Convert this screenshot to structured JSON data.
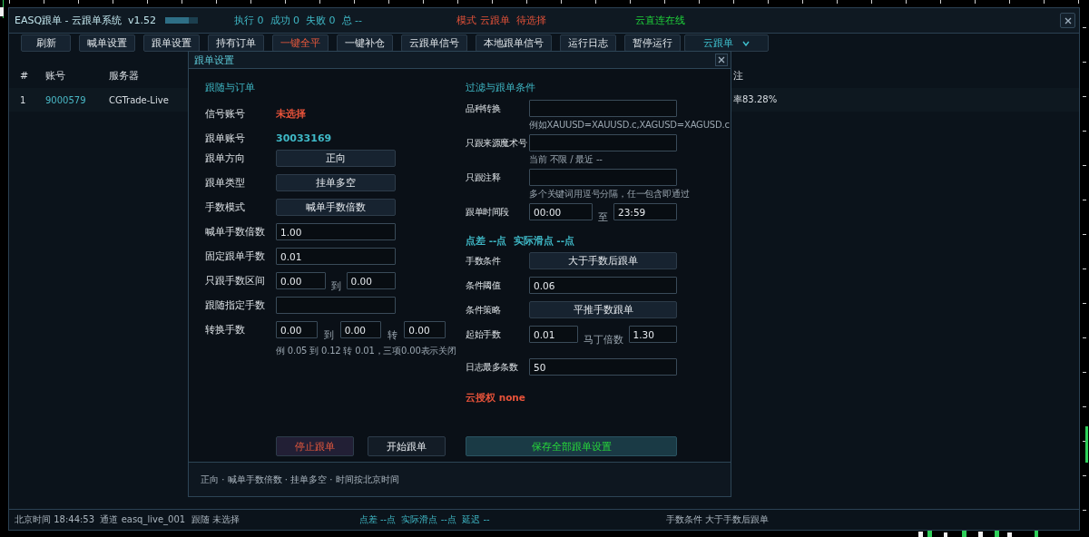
{
  "window": {
    "title": "EASQ跟单 - 云跟单系统  v1.52",
    "stats": "执行 0  成功 0  失败 0  总 --",
    "mode": "模式 云跟单  待选择",
    "connection": "云直连在线"
  },
  "toolbar": [
    {
      "label": "刷新",
      "kind": "normal"
    },
    {
      "label": "喊单设置",
      "kind": "normal"
    },
    {
      "label": "跟单设置",
      "kind": "normal"
    },
    {
      "label": "持有订单",
      "kind": "normal"
    },
    {
      "label": "一键全平",
      "kind": "danger"
    },
    {
      "label": "一键补仓",
      "kind": "normal"
    },
    {
      "label": "云跟单信号",
      "kind": "normal"
    },
    {
      "label": "本地跟单信号",
      "kind": "normal"
    },
    {
      "label": "运行日志",
      "kind": "normal"
    },
    {
      "label": "暂停运行",
      "kind": "normal"
    },
    {
      "label": "云跟单",
      "kind": "dropdown"
    }
  ],
  "table": {
    "columns": [
      "#",
      "账号",
      "服务器",
      "注"
    ],
    "rows": [
      [
        "1",
        "9000579",
        "CGTrade-Live",
        "率83.28%"
      ]
    ]
  },
  "dialog": {
    "title": "跟单设置",
    "left": {
      "heading": "跟随与订单",
      "items": [
        {
          "kind": "text",
          "label": "信号账号",
          "value": "未选择",
          "color": "#e8533a"
        },
        {
          "kind": "text",
          "label": "跟单账号",
          "value": "30033169",
          "color": "#3fb8c6"
        },
        {
          "kind": "select",
          "label": "跟单方向",
          "value": "正向"
        },
        {
          "kind": "select",
          "label": "跟单类型",
          "value": "挂单多空"
        },
        {
          "kind": "select",
          "label": "手数模式",
          "value": "喊单手数倍数"
        },
        {
          "kind": "input",
          "label": "喊单手数倍数",
          "value": "1.00"
        },
        {
          "kind": "input",
          "label": "固定跟单手数",
          "value": "0.01"
        },
        {
          "kind": "range",
          "label": "只跟手数区间",
          "values": [
            "0.00",
            "0.00"
          ],
          "separators": [
            "到"
          ]
        },
        {
          "kind": "input",
          "label": "跟随指定手数"
        },
        {
          "kind": "range",
          "label": "转换手数",
          "values": [
            "0.00",
            "0.00",
            "0.00"
          ],
          "separators": [
            "到",
            "转"
          ]
        },
        {
          "kind": "hint",
          "text": "例 0.05 到 0.12 转 0.01，三项0.00表示关闭"
        }
      ]
    },
    "right": {
      "heading": "过滤与跟单条件",
      "items": [
        {
          "kind": "input",
          "label": "品种转换"
        },
        {
          "kind": "hint",
          "text": "例如XAUUSD=XAUUSD.c,XAGUSD=XAGUSD.c"
        },
        {
          "kind": "input",
          "label": "只跟来源魔术号"
        },
        {
          "kind": "hint",
          "text": "当前 不限 / 最近 --"
        },
        {
          "kind": "input",
          "label": "只跟注释"
        },
        {
          "kind": "hint",
          "text": "多个关键词用逗号分隔，任一包含即通过"
        },
        {
          "kind": "range",
          "label": "跟单时间段",
          "values": [
            "00:00",
            "23:59"
          ],
          "separators": [
            "至"
          ]
        },
        {
          "kind": "note",
          "text": "点差 --点  实际滑点 --点",
          "color": "#3fb8c6"
        },
        {
          "kind": "select",
          "label": "手数条件",
          "value": "大于手数后跟单"
        },
        {
          "kind": "input",
          "label": "条件阈值",
          "value": "0.06"
        },
        {
          "kind": "select",
          "label": "条件策略",
          "value": "平推手数跟单"
        },
        {
          "kind": "range",
          "label": "起始手数",
          "values": [
            "0.01",
            "1.30"
          ],
          "separators": [
            "马丁倍数"
          ]
        },
        {
          "kind": "input",
          "label": "日志最多条数",
          "value": "50"
        },
        {
          "kind": "note",
          "text": "云授权 none",
          "color": "#e8533a"
        }
      ]
    },
    "actions": [
      {
        "label": "停止跟单",
        "kind": "danger"
      },
      {
        "label": "开始跟单",
        "kind": "normal"
      },
      {
        "label": "保存全部跟单设置",
        "kind": "primary"
      }
    ],
    "footer": "正向 · 喊单手数倍数 · 挂单多空 · 时间按北京时间"
  },
  "status_bar": {
    "left": "北京时间 18:44:53  通道 easq_live_001  跟随 未选择",
    "center": "点差 --点  实际滑点 --点  延迟 --",
    "right": "手数条件 大于手数后跟单"
  }
}
